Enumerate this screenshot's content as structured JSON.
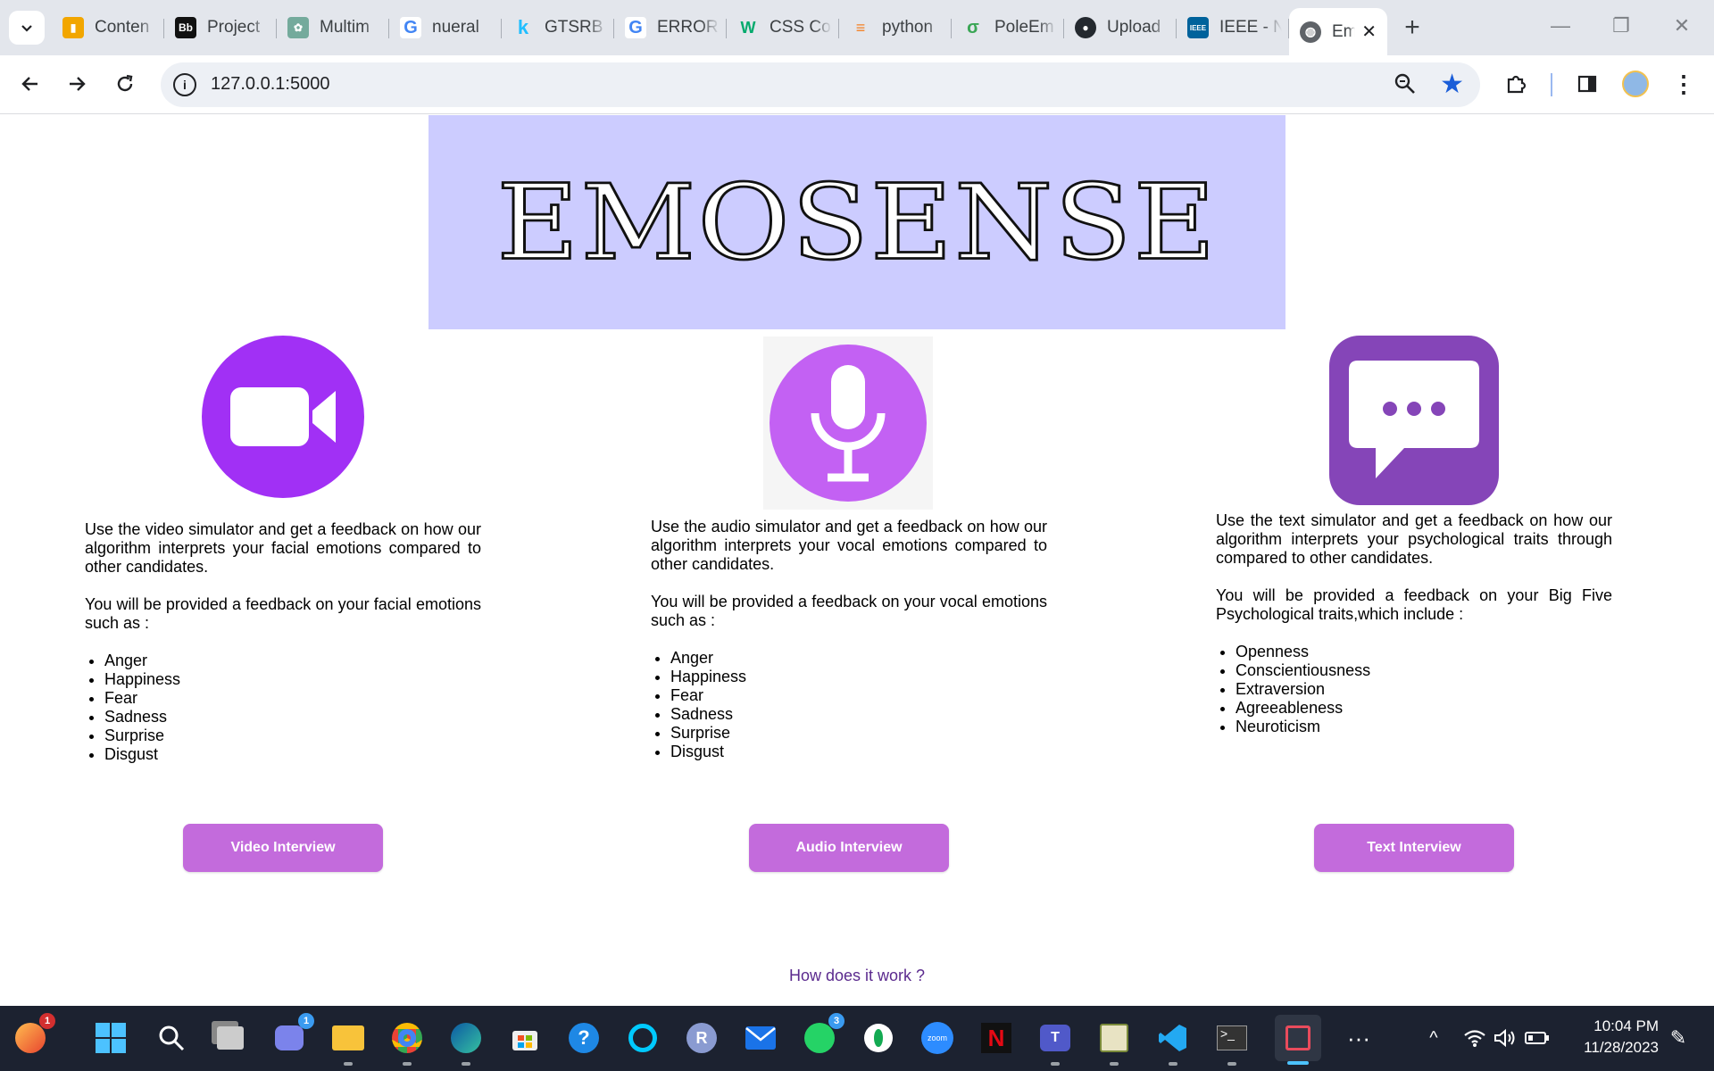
{
  "browser": {
    "tabs": [
      {
        "title": "Conten",
        "icon": "analytics-icon",
        "color": "#f2a600"
      },
      {
        "title": "Project",
        "icon": "blackboard-icon",
        "color": "#111111"
      },
      {
        "title": "Multim",
        "icon": "chatgpt-icon",
        "color": "#74aa9c"
      },
      {
        "title": "nueral",
        "icon": "google-icon",
        "color": "#4285f4"
      },
      {
        "title": "GTSRB",
        "icon": "kaggle-icon",
        "color": "#20beff"
      },
      {
        "title": "ERROR",
        "icon": "google-icon",
        "color": "#4285f4"
      },
      {
        "title": "CSS Co",
        "icon": "w3schools-icon",
        "color": "#04aa6d"
      },
      {
        "title": "python",
        "icon": "stackoverflow-icon",
        "color": "#f48024"
      },
      {
        "title": "PoleEm",
        "icon": "leaf-icon",
        "color": "#3aa655"
      },
      {
        "title": "Upload",
        "icon": "github-icon",
        "color": "#24292f"
      },
      {
        "title": "IEEE - N",
        "icon": "ieee-icon",
        "color": "#00629b"
      }
    ],
    "active_tab": {
      "title": "Em",
      "icon": "globe-icon"
    },
    "url": "127.0.0.1:5000"
  },
  "page": {
    "banner_title": "EMOSENSE",
    "accent_color": "#c36bdc",
    "sections": [
      {
        "icon": "video-camera-icon",
        "para1": "Use the video simulator and get a feedback on how our algorithm interprets your facial emotions compared to other candidates.",
        "para2": "You will be provided a feedback on your facial emotions such as :",
        "items": [
          "Anger",
          "Happiness",
          "Fear",
          "Sadness",
          "Surprise",
          "Disgust"
        ],
        "button": "Video Interview"
      },
      {
        "icon": "microphone-icon",
        "para1": "Use the audio simulator and get a feedback on how our algorithm interprets your vocal emotions compared to other candidates.",
        "para2": "You will be provided a feedback on your vocal emotions such as :",
        "items": [
          "Anger",
          "Happiness",
          "Fear",
          "Sadness",
          "Surprise",
          "Disgust"
        ],
        "button": "Audio Interview"
      },
      {
        "icon": "chat-bubble-icon",
        "para1": "Use the text simulator and get a feedback on how our algorithm interprets your psychological traits through compared to other candidates.",
        "para2": "You will be provided a feedback on your Big Five Psychological traits,which include :",
        "items": [
          "Openness",
          "Conscientiousness",
          "Extraversion",
          "Agreeableness",
          "Neuroticism"
        ],
        "button": "Text Interview"
      }
    ],
    "how_link": "How does it work ?"
  },
  "taskbar": {
    "badges": {
      "firefox": "1",
      "meet": "1",
      "whatsapp": "3"
    },
    "time": "10:04 PM",
    "date": "11/28/2023"
  }
}
